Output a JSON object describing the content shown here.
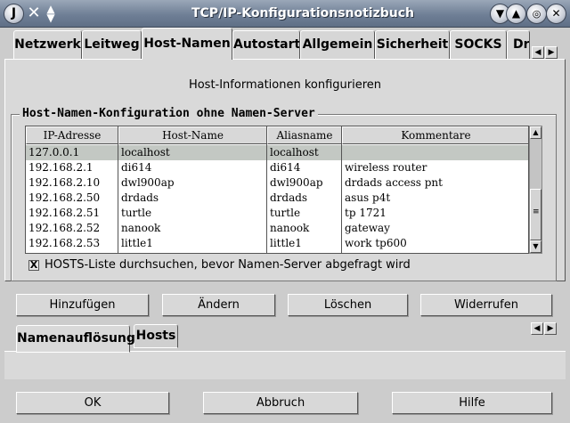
{
  "window": {
    "title": "TCP/IP-Konfigurationsnotizbuch",
    "icons": {
      "app": "java-logo-icon",
      "close": "x-icon",
      "menu": "up-down-arrows-icon"
    }
  },
  "tabs": [
    {
      "label": "Netzwerk"
    },
    {
      "label": "Leitweg"
    },
    {
      "label": "Host-Namen",
      "active": true
    },
    {
      "label": "Autostart"
    },
    {
      "label": "Allgemein"
    },
    {
      "label": "Sicherheit"
    },
    {
      "label": "SOCKS"
    },
    {
      "label": "Dr"
    }
  ],
  "page": {
    "subtitle": "Host-Informationen konfigurieren",
    "group_label": "Host-Namen-Konfiguration ohne Namen-Server"
  },
  "table": {
    "columns": [
      "IP-Adresse",
      "Host-Name",
      "Aliasname",
      "Kommentare"
    ],
    "rows": [
      {
        "ip": "127.0.0.1",
        "host": "localhost",
        "alias": "localhost",
        "comment": "",
        "selected": true
      },
      {
        "ip": "192.168.2.1",
        "host": "di614",
        "alias": "di614",
        "comment": "wireless router"
      },
      {
        "ip": "192.168.2.10",
        "host": "dwl900ap",
        "alias": "dwl900ap",
        "comment": "drdads access pnt"
      },
      {
        "ip": "192.168.2.50",
        "host": "drdads",
        "alias": "drdads",
        "comment": "asus p4t"
      },
      {
        "ip": "192.168.2.51",
        "host": "turtle",
        "alias": "turtle",
        "comment": "tp 1721"
      },
      {
        "ip": "192.168.2.52",
        "host": "nanook",
        "alias": "nanook",
        "comment": "gateway"
      },
      {
        "ip": "192.168.2.53",
        "host": "little1",
        "alias": "little1",
        "comment": "work tp600"
      }
    ]
  },
  "checkbox": {
    "label": "HOSTS-Liste durchsuchen, bevor Namen-Server abgefragt wird",
    "checked": true,
    "mark": "X"
  },
  "buttons": {
    "add": "Hinzufügen",
    "change": "Ändern",
    "delete": "Löschen",
    "undo": "Widerrufen"
  },
  "subtabs": [
    {
      "label": "Namenauflösung",
      "active": true
    },
    {
      "label": "Hosts"
    }
  ],
  "footer": {
    "ok": "OK",
    "cancel": "Abbruch",
    "help": "Hilfe"
  }
}
